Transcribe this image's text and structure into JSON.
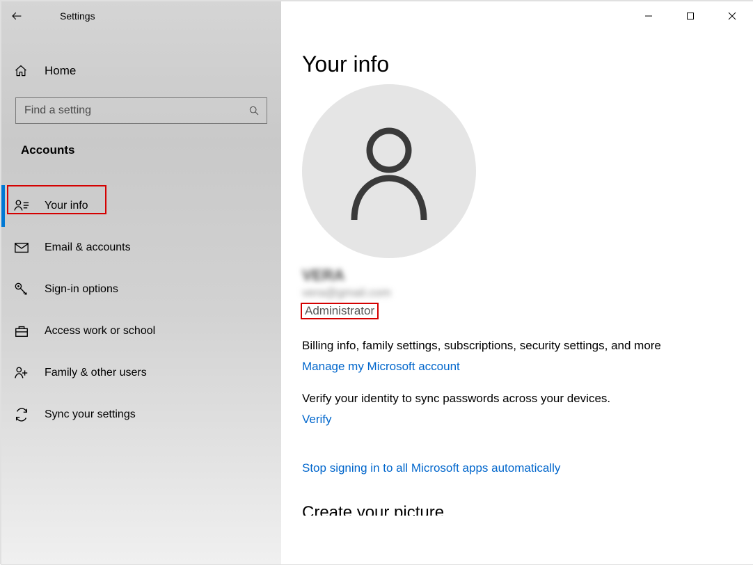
{
  "app": {
    "title": "Settings"
  },
  "sidebar": {
    "home_label": "Home",
    "search_placeholder": "Find a setting",
    "section_title": "Accounts",
    "items": [
      {
        "label": "Your info"
      },
      {
        "label": "Email & accounts"
      },
      {
        "label": "Sign-in options"
      },
      {
        "label": "Access work or school"
      },
      {
        "label": "Family & other users"
      },
      {
        "label": "Sync your settings"
      }
    ]
  },
  "page": {
    "title": "Your info",
    "username": "VERA",
    "useremail": "vera@gmail.com",
    "role": "Administrator",
    "billing_text": "Billing info, family settings, subscriptions, security settings, and more",
    "manage_link": "Manage my Microsoft account",
    "verify_text": "Verify your identity to sync passwords across your devices.",
    "verify_link": "Verify",
    "stop_link": "Stop signing in to all Microsoft apps automatically",
    "cut_heading": "Create your picture"
  }
}
